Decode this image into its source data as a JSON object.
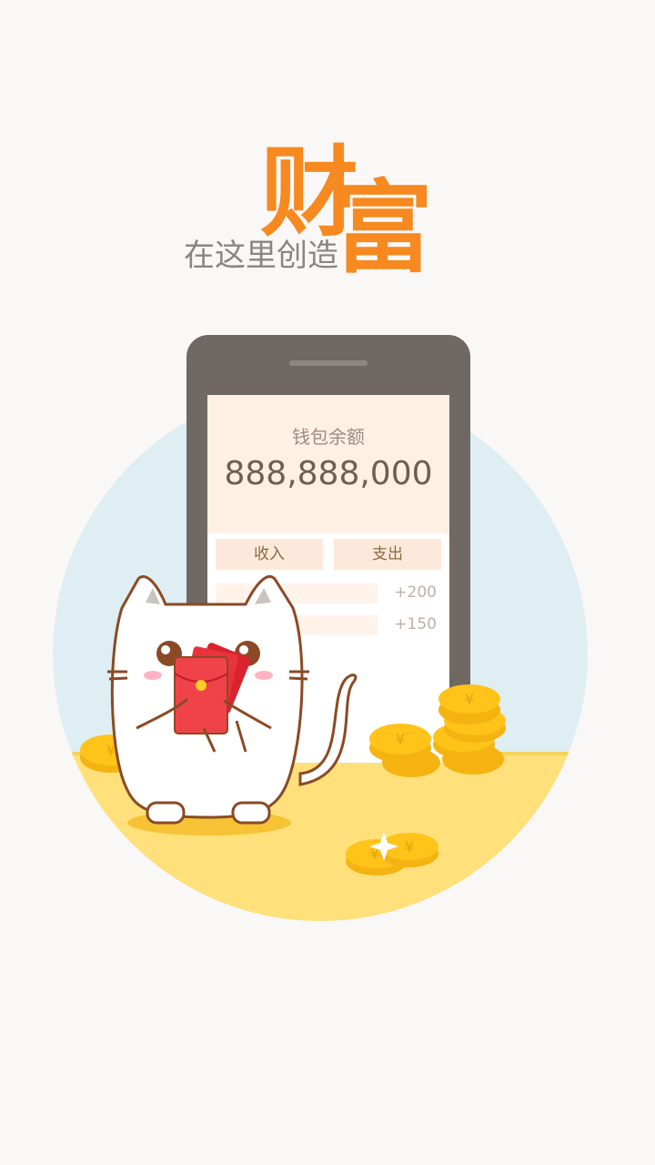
{
  "headline": {
    "word_1": "财",
    "word_2": "富",
    "subtitle": "在这里创造"
  },
  "phone": {
    "balance_label": "钱包余额",
    "balance_value": "888,888,000",
    "tabs": [
      "收入",
      "支出"
    ],
    "transactions": [
      "+200",
      "+150"
    ]
  },
  "icons": [
    "phone-illustration",
    "cat-mascot",
    "red-envelope-icon",
    "gold-coin-icon",
    "sparkle-icon"
  ],
  "colors": {
    "accent": "#f6891f",
    "background": "#f9f8f6",
    "circle_sky": "#deeef2",
    "floor": "#ffe07a",
    "coin": "#ffc31a",
    "phone_body": "#6f6863",
    "phone_screen": "#fff0e4"
  }
}
